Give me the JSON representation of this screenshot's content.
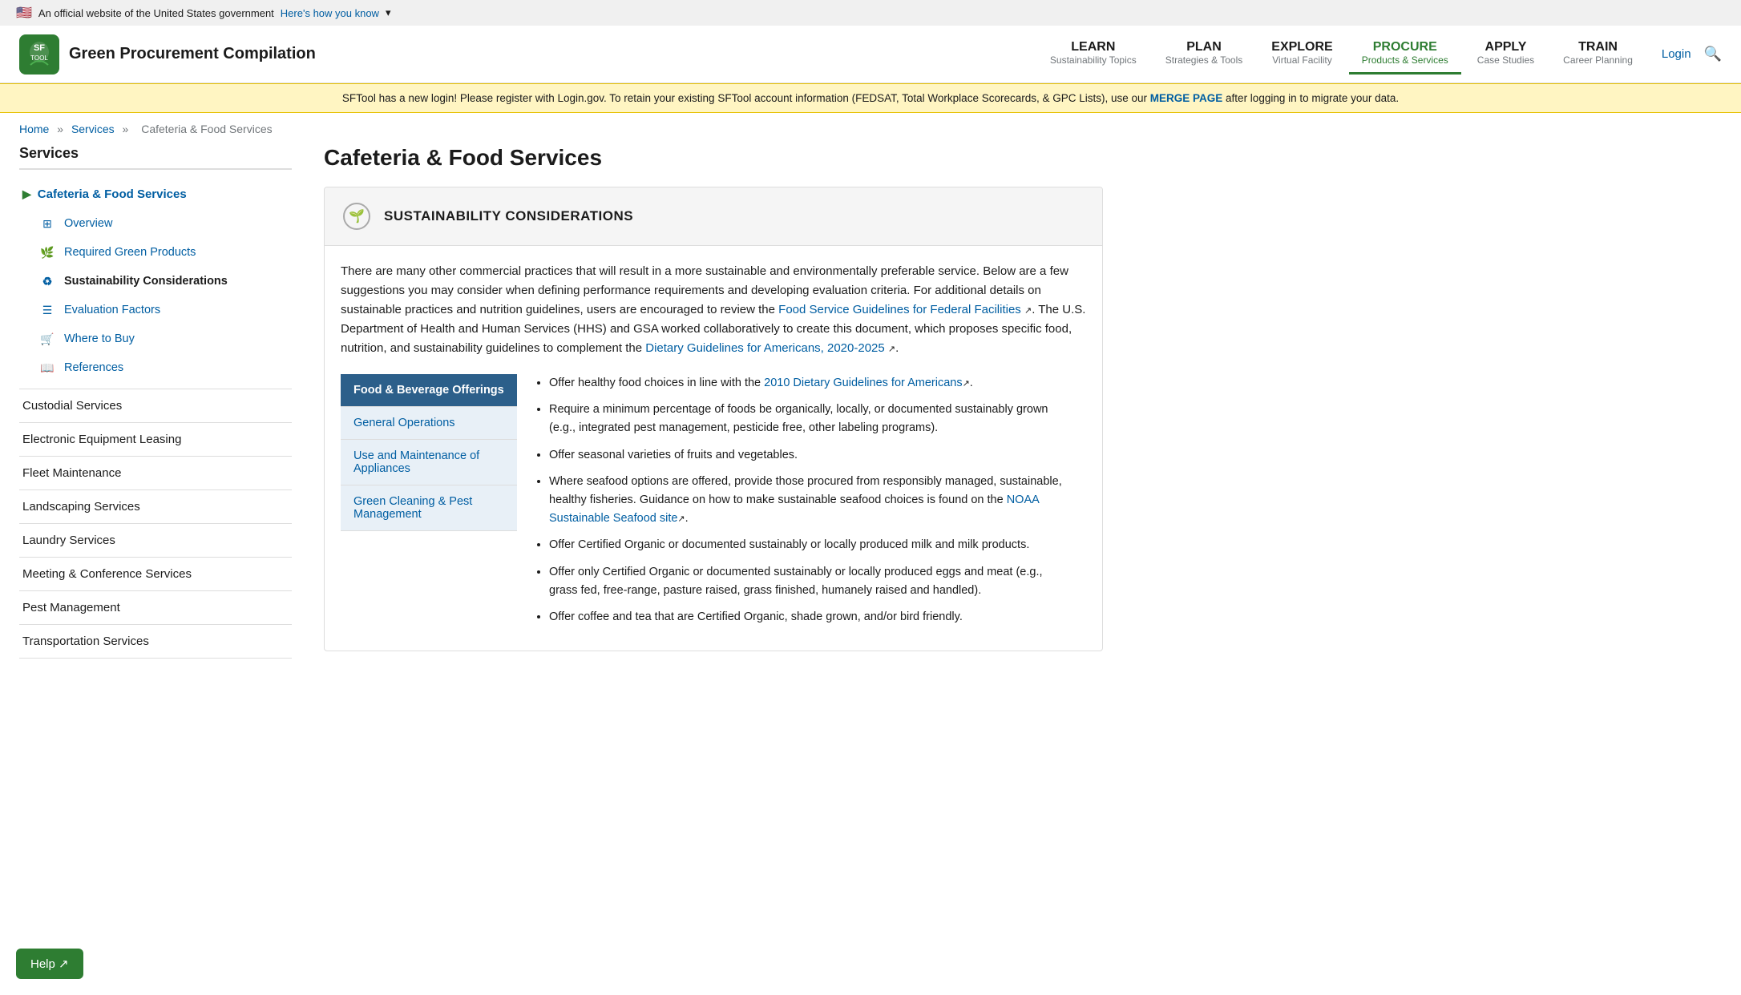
{
  "gov_banner": {
    "flag": "🇺🇸",
    "text": "An official website of the United States government",
    "link_text": "Here's how you know",
    "link_url": "#"
  },
  "alert_banner": {
    "text_before": "SFTool has a new login! Please register with Login.gov. To retain your existing SFTool account information (FEDSAT, Total Workplace Scorecards, & GPC Lists), use our ",
    "link_text": "MERGE PAGE",
    "link_url": "#",
    "text_after": " after logging in to migrate your data."
  },
  "header": {
    "site_title": "Green Procurement Compilation",
    "login_label": "Login",
    "nav_items": [
      {
        "label": "LEARN",
        "sub": "Sustainability Topics",
        "active": false
      },
      {
        "label": "PLAN",
        "sub": "Strategies & Tools",
        "active": false
      },
      {
        "label": "EXPLORE",
        "sub": "Virtual Facility",
        "active": false
      },
      {
        "label": "PROCURE",
        "sub": "Products & Services",
        "active": true
      },
      {
        "label": "APPLY",
        "sub": "Case Studies",
        "active": false
      },
      {
        "label": "TRAIN",
        "sub": "Career Planning",
        "active": false
      }
    ]
  },
  "breadcrumb": {
    "items": [
      "Home",
      "Services",
      "Cafeteria & Food Services"
    ],
    "separators": [
      "»",
      "»"
    ]
  },
  "sidebar": {
    "title": "Services",
    "active_section": "Cafeteria & Food Services",
    "sub_items": [
      {
        "label": "Overview",
        "icon": "grid",
        "active": false
      },
      {
        "label": "Required Green Products",
        "icon": "leaf",
        "active": false
      },
      {
        "label": "Sustainability Considerations",
        "icon": "recycle",
        "active": true
      },
      {
        "label": "Evaluation Factors",
        "icon": "list",
        "active": false
      },
      {
        "label": "Where to Buy",
        "icon": "cart",
        "active": false
      },
      {
        "label": "References",
        "icon": "book",
        "active": false
      }
    ],
    "plain_items": [
      "Custodial Services",
      "Electronic Equipment Leasing",
      "Fleet Maintenance",
      "Landscaping Services",
      "Laundry Services",
      "Meeting & Conference Services",
      "Pest Management",
      "Transportation Services"
    ]
  },
  "content": {
    "page_title": "Cafeteria & Food Services",
    "sustainability_heading": "SUSTAINABILITY CONSIDERATIONS",
    "intro_text": "There are many other commercial practices that will result in a more sustainable and environmentally preferable service.  Below are a few suggestions you may consider when defining performance requirements and developing evaluation criteria.  For additional details on sustainable practices and nutrition guidelines, users are encouraged to review the ",
    "link1_text": "Food Service Guidelines for Federal Facilities",
    "link1_url": "#",
    "intro_text2": ". The U.S. Department of Health and Human Services (HHS) and GSA worked collaboratively to create this document, which proposes specific food, nutrition, and sustainability guidelines to complement the ",
    "link2_text": "Dietary Guidelines for Americans, 2020-2025",
    "link2_url": "#",
    "intro_text3": ".",
    "tabs": [
      {
        "label": "Food & Beverage Offerings",
        "active": true,
        "is_header": true
      },
      {
        "label": "General Operations",
        "active": false,
        "is_header": false
      },
      {
        "label": "Use and Maintenance of Appliances",
        "active": false,
        "is_header": false
      },
      {
        "label": "Green Cleaning & Pest Management",
        "active": false,
        "is_header": false
      }
    ],
    "bullets": [
      {
        "text_before": "Offer healthy food choices in line with the ",
        "link_text": "2010 Dietary Guidelines for Americans",
        "link_url": "#",
        "text_after": "."
      },
      {
        "text_before": "Require a minimum percentage of foods be organically, locally, or documented sustainably grown (e.g., integrated pest management, pesticide free, other labeling programs).",
        "link_text": "",
        "link_url": "",
        "text_after": ""
      },
      {
        "text_before": "Offer seasonal varieties of fruits and vegetables.",
        "link_text": "",
        "link_url": "",
        "text_after": ""
      },
      {
        "text_before": "Where seafood options are offered, provide those procured from responsibly managed, sustainable, healthy fisheries.  Guidance on how to make sustainable seafood choices is found on the ",
        "link_text": "NOAA Sustainable Seafood site",
        "link_url": "#",
        "text_after": "."
      },
      {
        "text_before": "Offer Certified Organic or documented sustainably or locally produced milk and milk products.",
        "link_text": "",
        "link_url": "",
        "text_after": ""
      },
      {
        "text_before": "Offer only Certified Organic or documented sustainably or locally produced eggs and meat (e.g., grass fed, free-range, pasture raised, grass finished, humanely raised and handled).",
        "link_text": "",
        "link_url": "",
        "text_after": ""
      },
      {
        "text_before": "Offer coffee and tea that are Certified Organic, shade grown, and/or bird friendly.",
        "link_text": "",
        "link_url": "",
        "text_after": ""
      }
    ]
  },
  "help_button": {
    "label": "Help ↗"
  }
}
